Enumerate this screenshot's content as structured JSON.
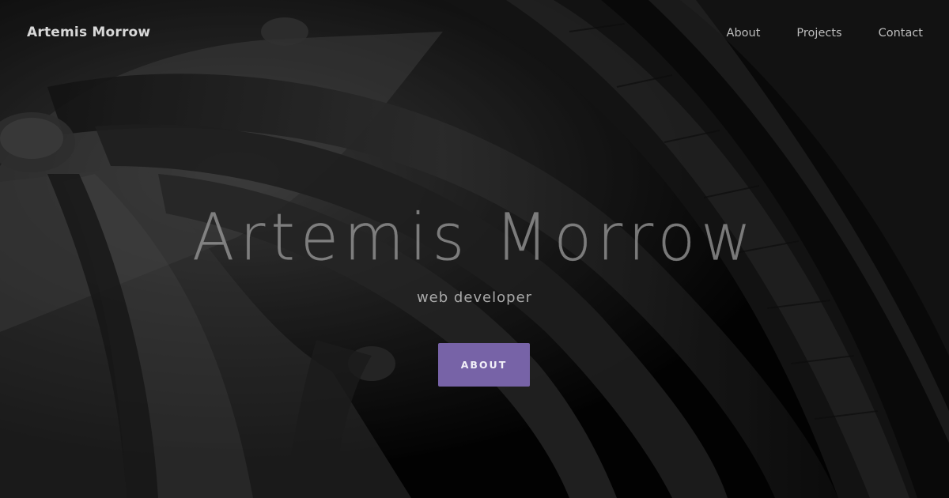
{
  "header": {
    "brand": "Artemis Morrow",
    "nav": [
      {
        "label": "About"
      },
      {
        "label": "Projects"
      },
      {
        "label": "Contact"
      }
    ]
  },
  "hero": {
    "title": "Artemis Morrow",
    "subtitle": "web developer",
    "cta_label": "ABOUT"
  },
  "colors": {
    "accent": "#7763a7",
    "background": "#000000",
    "text": "#bdbdbd"
  }
}
